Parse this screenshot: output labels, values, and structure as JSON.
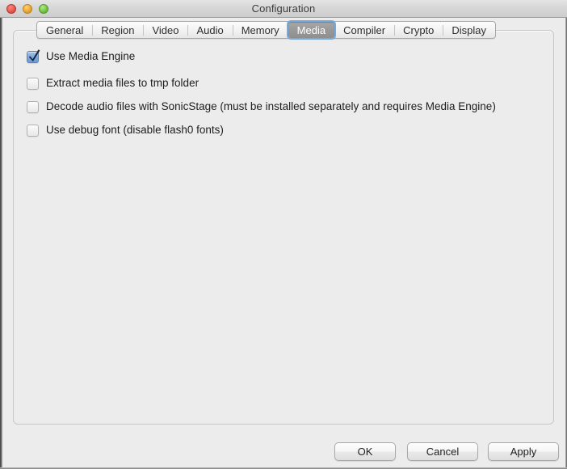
{
  "window": {
    "title": "Configuration",
    "traffic_lights": [
      {
        "name": "close",
        "color": "#ec6359"
      },
      {
        "name": "minimize",
        "color": "#f0b03c"
      },
      {
        "name": "maximize",
        "color": "#84cc52"
      }
    ]
  },
  "tabs": {
    "selected": "Media",
    "items": [
      {
        "label": "General",
        "selected": false
      },
      {
        "label": "Region",
        "selected": false
      },
      {
        "label": "Video",
        "selected": false
      },
      {
        "label": "Audio",
        "selected": false
      },
      {
        "label": "Memory",
        "selected": false
      },
      {
        "label": "Media",
        "selected": true
      },
      {
        "label": "Compiler",
        "selected": false
      },
      {
        "label": "Crypto",
        "selected": false
      },
      {
        "label": "Display",
        "selected": false
      }
    ]
  },
  "media_panel": {
    "options": [
      {
        "label": "Use Media Engine",
        "checked": true
      },
      {
        "label": "Extract media files to tmp folder",
        "checked": false
      },
      {
        "label": "Decode audio files with SonicStage (must be installed separately and requires Media Engine)",
        "checked": false
      },
      {
        "label": "Use debug font (disable flash0 fonts)",
        "checked": false
      }
    ]
  },
  "footer": {
    "ok_label": "OK",
    "cancel_label": "Cancel",
    "apply_label": "Apply"
  },
  "colors": {
    "window_bg": "#ececec",
    "titlebar_top": "#e4e4e4",
    "titlebar_bottom": "#cdcdcd",
    "panel_border": "#c6c6c6",
    "selected_tab_bg": "#999999",
    "focus_ring": "#75aadb",
    "checkbox_on": "#7fa9de",
    "text": "#1d1d1d"
  }
}
